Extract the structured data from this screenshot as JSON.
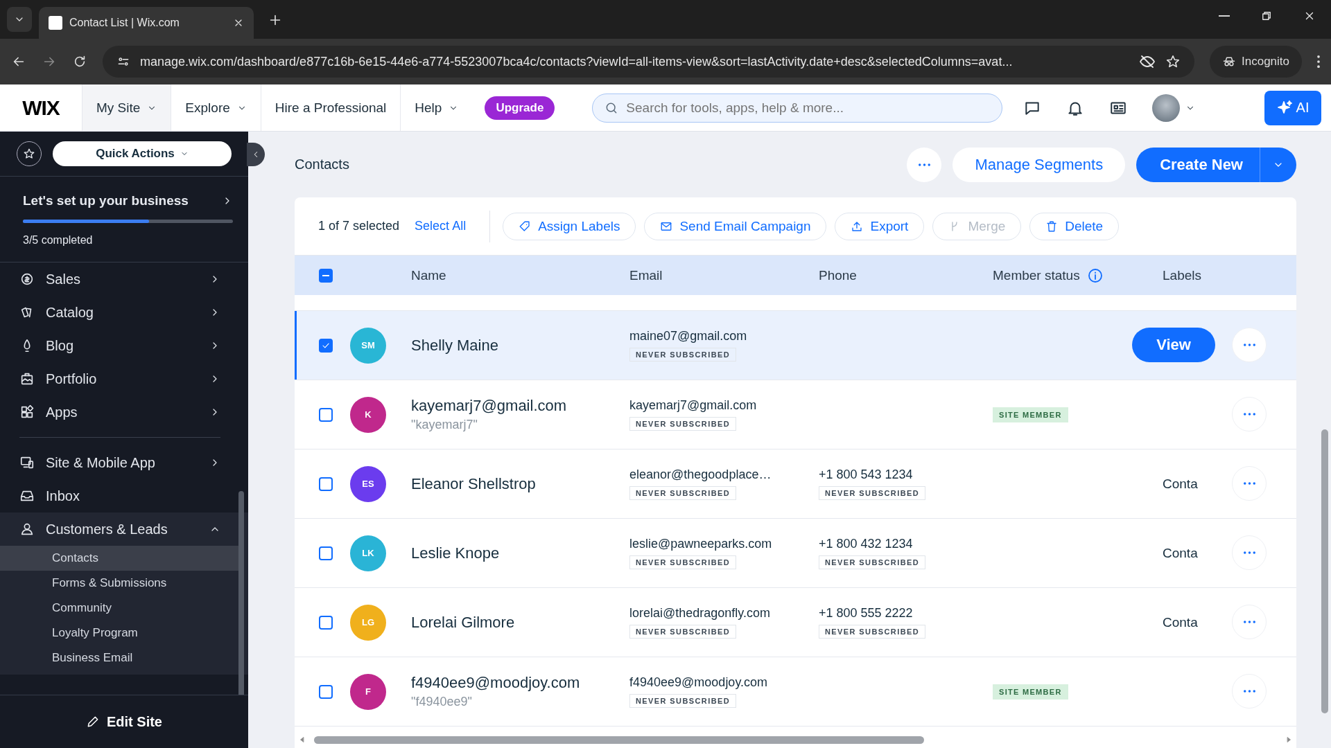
{
  "browser": {
    "tab_title": "Contact List | Wix.com",
    "url": "manage.wix.com/dashboard/e877c16b-6e15-44e6-a774-5523007bca4c/contacts?viewId=all-items-view&sort=lastActivity.date+desc&selectedColumns=avat...",
    "profile": "Incognito"
  },
  "topbar": {
    "logo": "WIX",
    "menu": [
      {
        "label": "My Site",
        "dropdown": true,
        "selected": true
      },
      {
        "label": "Explore",
        "dropdown": true,
        "selected": false
      },
      {
        "label": "Hire a Professional",
        "dropdown": false,
        "selected": false
      },
      {
        "label": "Help",
        "dropdown": true,
        "selected": false
      }
    ],
    "upgrade": "Upgrade",
    "search": {
      "placeholder": "Search for tools, apps, help & more..."
    },
    "ai": "AI"
  },
  "sidebar": {
    "quick_actions": "Quick Actions",
    "setup": {
      "title": "Let's set up your business",
      "level": 0.6,
      "progress": "3/5 completed"
    },
    "sections": [
      [
        {
          "label": "Sales",
          "kind": "group",
          "expanded": false
        },
        {
          "label": "Catalog",
          "kind": "group",
          "expanded": false
        },
        {
          "label": "Blog",
          "kind": "group",
          "expanded": false
        },
        {
          "label": "Portfolio",
          "kind": "group",
          "expanded": false
        },
        {
          "label": "Apps",
          "kind": "group",
          "expanded": false
        }
      ],
      [
        {
          "label": "Site & Mobile App",
          "kind": "group",
          "expanded": false
        },
        {
          "label": "Inbox",
          "kind": "link",
          "expanded": false
        },
        {
          "label": "Customers & Leads",
          "kind": "group",
          "expanded": true,
          "children": [
            {
              "label": "Contacts",
              "selected": true
            },
            {
              "label": "Forms & Submissions",
              "selected": false
            },
            {
              "label": "Community",
              "selected": false
            },
            {
              "label": "Loyalty Program",
              "selected": false
            },
            {
              "label": "Business Email",
              "selected": false
            }
          ]
        }
      ]
    ],
    "edit_site": "Edit Site"
  },
  "page": {
    "title": "Contacts",
    "manage_segments": "Manage Segments",
    "create_new": "Create New"
  },
  "table": {
    "selection": "1 of 7 selected",
    "select_all": "Select All",
    "actions": [
      {
        "label": "Assign Labels",
        "disabled": false
      },
      {
        "label": "Send Email Campaign",
        "disabled": false
      },
      {
        "label": "Export",
        "disabled": false
      },
      {
        "label": "Merge",
        "disabled": true
      },
      {
        "label": "Delete",
        "disabled": false
      }
    ],
    "header_checkbox_partial": true,
    "columns": [
      "Name",
      "Email",
      "Phone",
      "Member status",
      "Labels"
    ],
    "rows": [
      {
        "initials": "SM",
        "color": "#29b6d5",
        "name": "Shelly Maine",
        "email": "maine07@gmail.com",
        "email_status": "NEVER SUBSCRIBED",
        "selected": true,
        "action": "View"
      },
      {
        "initials": "K",
        "color": "#c0288c",
        "name": "kayemarj7@gmail.com",
        "nickname": "\"kayemarj7\"",
        "email": "kayemarj7@gmail.com",
        "email_status": "NEVER SUBSCRIBED",
        "member_status": "SITE MEMBER",
        "selected": false
      },
      {
        "initials": "ES",
        "color": "#6b3cee",
        "name": "Eleanor Shellstrop",
        "email": "eleanor@thegoodplace…",
        "email_status": "NEVER SUBSCRIBED",
        "phone": "+1 800 543 1234",
        "phone_status": "NEVER SUBSCRIBED",
        "labels": "Conta",
        "selected": false
      },
      {
        "initials": "LK",
        "color": "#2ab4d6",
        "name": "Leslie Knope",
        "email": "leslie@pawneeparks.com",
        "email_status": "NEVER SUBSCRIBED",
        "phone": "+1 800 432 1234",
        "phone_status": "NEVER SUBSCRIBED",
        "labels": "Conta",
        "selected": false
      },
      {
        "initials": "LG",
        "color": "#f0b01c",
        "name": "Lorelai Gilmore",
        "email": "lorelai@thedragonfly.com",
        "email_status": "NEVER SUBSCRIBED",
        "phone": "+1 800 555 2222",
        "phone_status": "NEVER SUBSCRIBED",
        "labels": "Conta",
        "selected": false
      },
      {
        "initials": "F",
        "color": "#c0288c",
        "name": "f4940ee9@moodjoy.com",
        "nickname": "\"f4940ee9\"",
        "email": "f4940ee9@moodjoy.com",
        "email_status": "NEVER SUBSCRIBED",
        "member_status": "SITE MEMBER",
        "selected": false
      }
    ]
  }
}
